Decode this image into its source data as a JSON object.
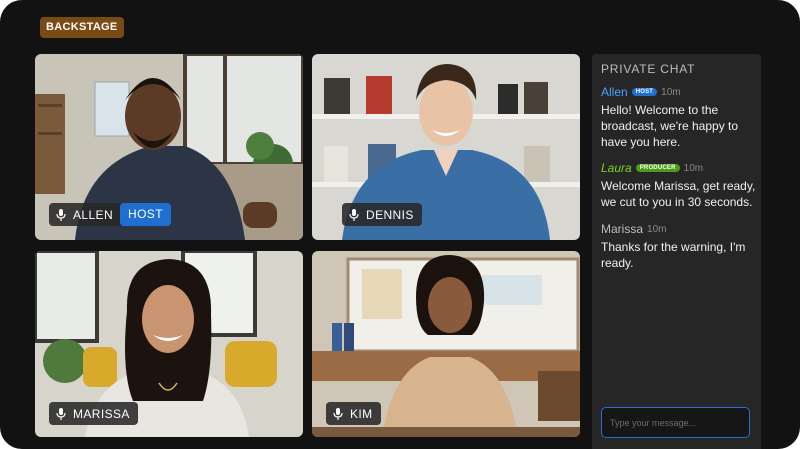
{
  "header": {
    "backstage_label": "BACKSTAGE"
  },
  "participants": [
    {
      "name": "ALLEN",
      "role_tag": "HOST",
      "mic_icon": "mic-icon"
    },
    {
      "name": "DENNIS",
      "mic_icon": "mic-icon"
    },
    {
      "name": "MARISSA",
      "mic_icon": "mic-icon"
    },
    {
      "name": "KIM",
      "mic_icon": "mic-icon"
    }
  ],
  "chat": {
    "title": "PRIVATE CHAT",
    "messages": [
      {
        "sender": "Allen",
        "role": "HOST",
        "time": "10m",
        "text": "Hello! Welcome to the broadcast, we're happy to have you here.",
        "sender_color": "#4aa3ff",
        "role_color": "#1f6fd1"
      },
      {
        "sender": "Laura",
        "role": "PRODUCER",
        "time": "10m",
        "text": "Welcome Marissa, get ready, we cut to you in 30 seconds.",
        "sender_color": "#7ed321",
        "role_color": "#4e9a1a"
      },
      {
        "sender": "Marissa",
        "role": "",
        "time": "10m",
        "text": "Thanks for the warning, I'm ready.",
        "sender_color": "#bdbdbd"
      }
    ],
    "input_placeholder": "Type your message..."
  },
  "colors": {
    "accent": "#1f6fd1",
    "backstage": "#7a4a14",
    "producer": "#4e9a1a"
  }
}
